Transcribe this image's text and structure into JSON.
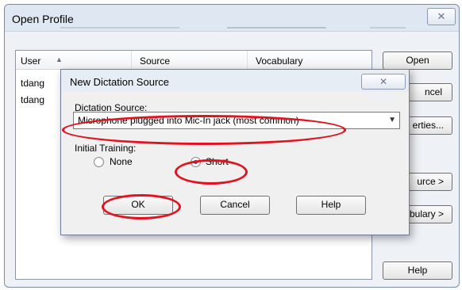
{
  "outer_window": {
    "title": "Open Profile",
    "close_glyph": "✕",
    "columns": [
      "User",
      "Source",
      "Vocabulary"
    ],
    "rows": [
      {
        "user": "tdang"
      },
      {
        "user": "tdang"
      }
    ],
    "buttons": {
      "open": "Open",
      "cancel": "ncel",
      "properties": "erties...",
      "new_source": "urce >",
      "new_vocabulary": "bulary >",
      "help": "Help"
    }
  },
  "dialog": {
    "title": "New Dictation Source",
    "close_glyph": "✕",
    "source_label": "Dictation Source:",
    "source_value": "Microphone plugged into Mic-In jack (most common)",
    "training_label": "Initial Training:",
    "option_none": "None",
    "option_short": "Short",
    "selected_option": "Short",
    "ok_label": "OK",
    "cancel_label": "Cancel",
    "help_label": "Help"
  },
  "annotation_color": "#e4121c"
}
